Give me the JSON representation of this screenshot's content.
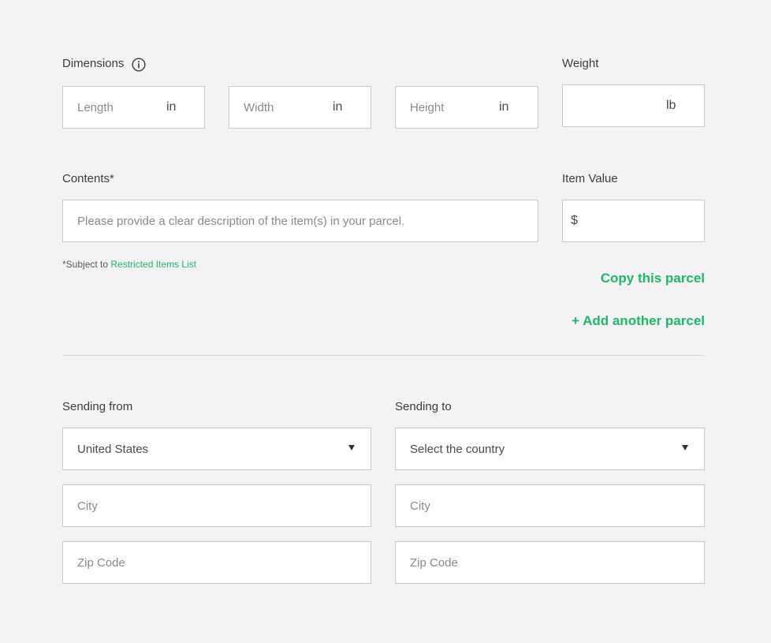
{
  "dimensions": {
    "label": "Dimensions",
    "icon": "info-icon",
    "length": {
      "placeholder": "Length",
      "unit": "in"
    },
    "width": {
      "placeholder": "Width",
      "unit": "in"
    },
    "height": {
      "placeholder": "Height",
      "unit": "in"
    }
  },
  "weight": {
    "label": "Weight",
    "unit": "lb"
  },
  "contents": {
    "label": "Contents*",
    "placeholder": "Please provide a clear description of the item(s) in your parcel.",
    "note_prefix": "*Subject to ",
    "note_link": "Restricted Items List"
  },
  "item_value": {
    "label": "Item Value",
    "currency": "$"
  },
  "actions": {
    "copy": "Copy this parcel",
    "add": "+ Add another parcel"
  },
  "from": {
    "label": "Sending from",
    "country": "United States",
    "city_placeholder": "City",
    "zip_placeholder": "Zip Code"
  },
  "to": {
    "label": "Sending to",
    "country_placeholder": "Select the country",
    "city_placeholder": "City",
    "zip_placeholder": "Zip Code"
  },
  "colors": {
    "accent": "#1fb866",
    "background": "#f3f2f5"
  }
}
